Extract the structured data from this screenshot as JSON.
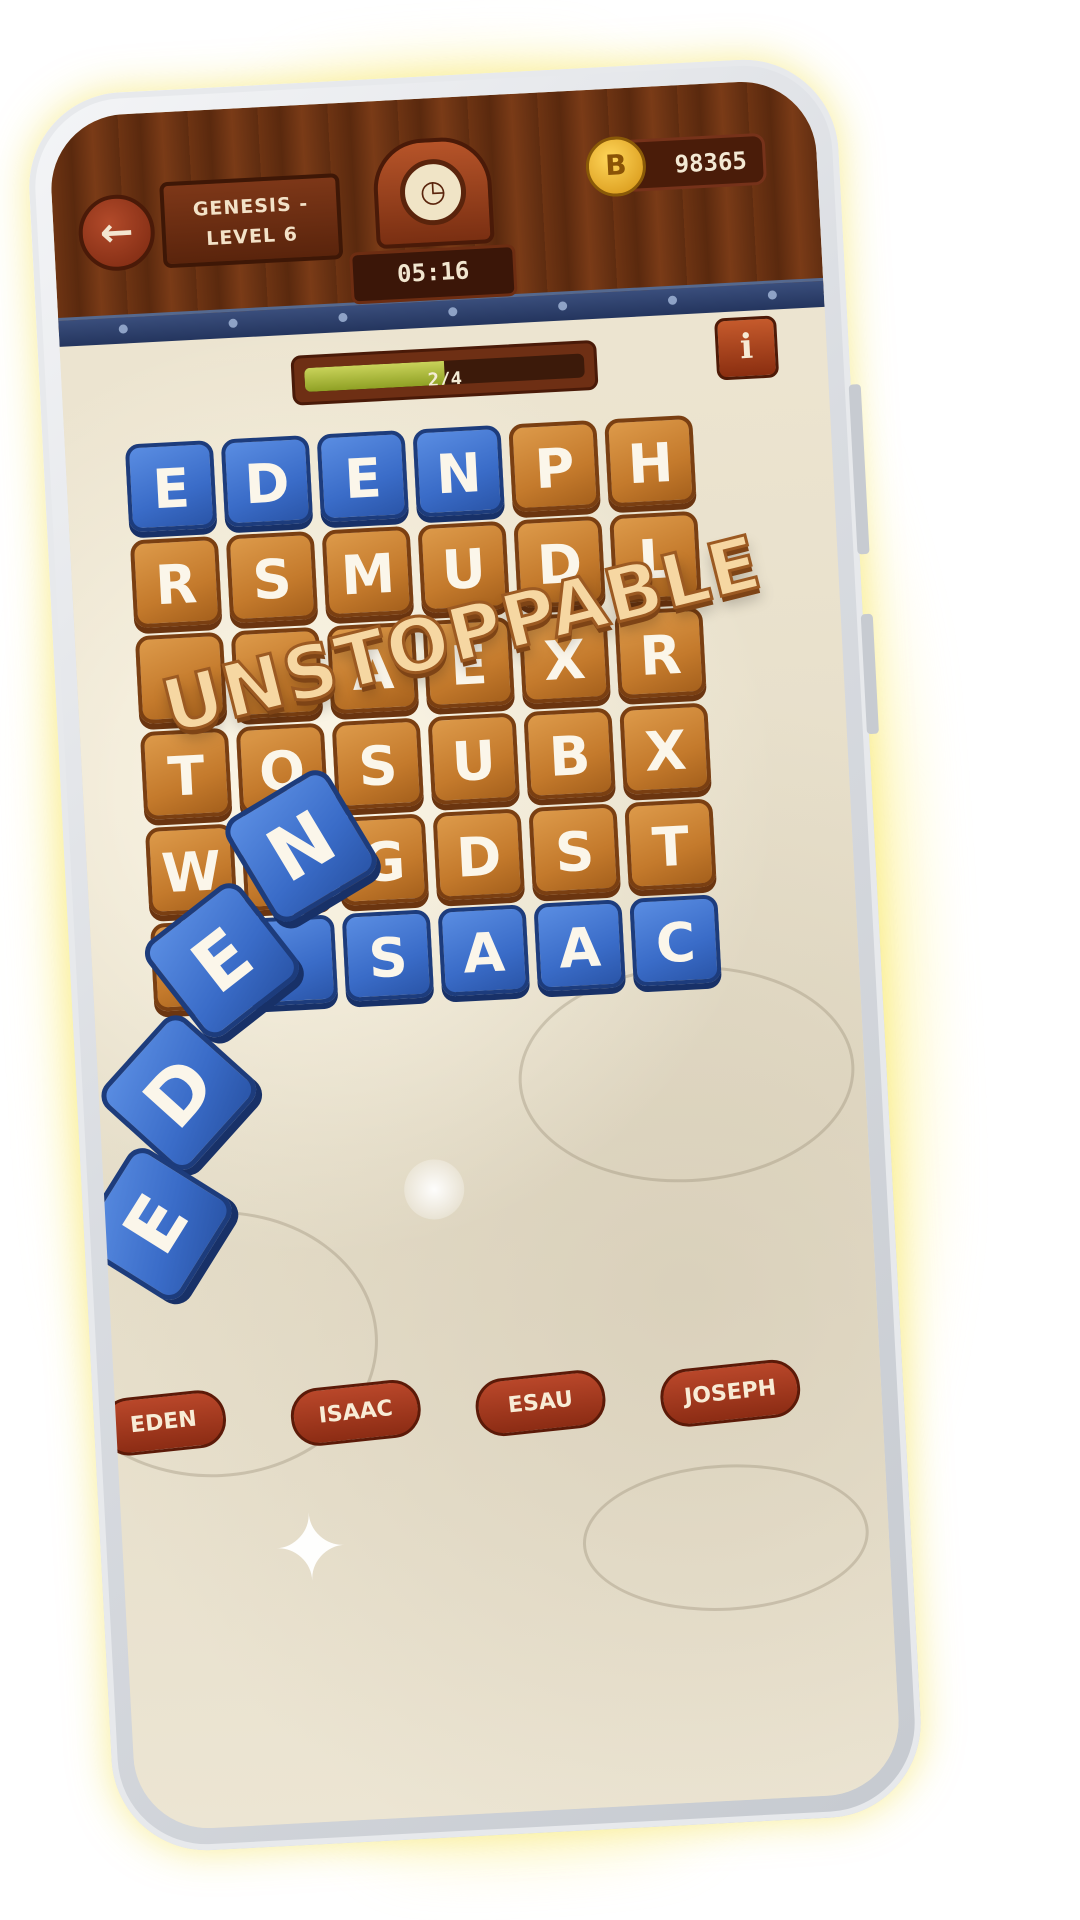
{
  "header": {
    "back_icon": "arrow-left-icon",
    "level_line1": "GENESIS -",
    "level_line2": "LEVEL 6",
    "clock_icon": "alarm-clock-icon",
    "timer": "05:16",
    "coin_icon": "coin-icon",
    "coin_symbol": "B",
    "coins": "98365"
  },
  "progress": {
    "label": "2/4",
    "fraction": 0.5
  },
  "info_button": {
    "icon": "info-icon",
    "label": "i"
  },
  "banner": "UNSTOPPABLE",
  "grid": {
    "rows": [
      [
        "E",
        "D",
        "E",
        "N",
        "P",
        "H"
      ],
      [
        "R",
        "S",
        "M",
        "U",
        "D",
        "L"
      ],
      [
        "",
        "",
        "A",
        "E",
        "X",
        "R"
      ],
      [
        "T",
        "O",
        "S",
        "U",
        "B",
        "X"
      ],
      [
        "W",
        "",
        "G",
        "D",
        "S",
        "T"
      ],
      [
        "",
        "",
        "S",
        "A",
        "A",
        "C"
      ]
    ],
    "highlight": [
      [
        true,
        true,
        true,
        true,
        false,
        false
      ],
      [
        false,
        false,
        false,
        false,
        false,
        false
      ],
      [
        false,
        false,
        false,
        false,
        false,
        false
      ],
      [
        false,
        false,
        false,
        false,
        false,
        false
      ],
      [
        false,
        false,
        false,
        false,
        false,
        false
      ],
      [
        false,
        true,
        true,
        true,
        true,
        true
      ]
    ]
  },
  "flying_letters": [
    "N",
    "E",
    "D",
    "E"
  ],
  "words": [
    "EDEN",
    "ISAAC",
    "ESAU",
    "JOSEPH"
  ],
  "colors": {
    "wood_tile": "#c47a2c",
    "blue_tile": "#3a6cc8",
    "accent_red": "#8c2c14"
  }
}
